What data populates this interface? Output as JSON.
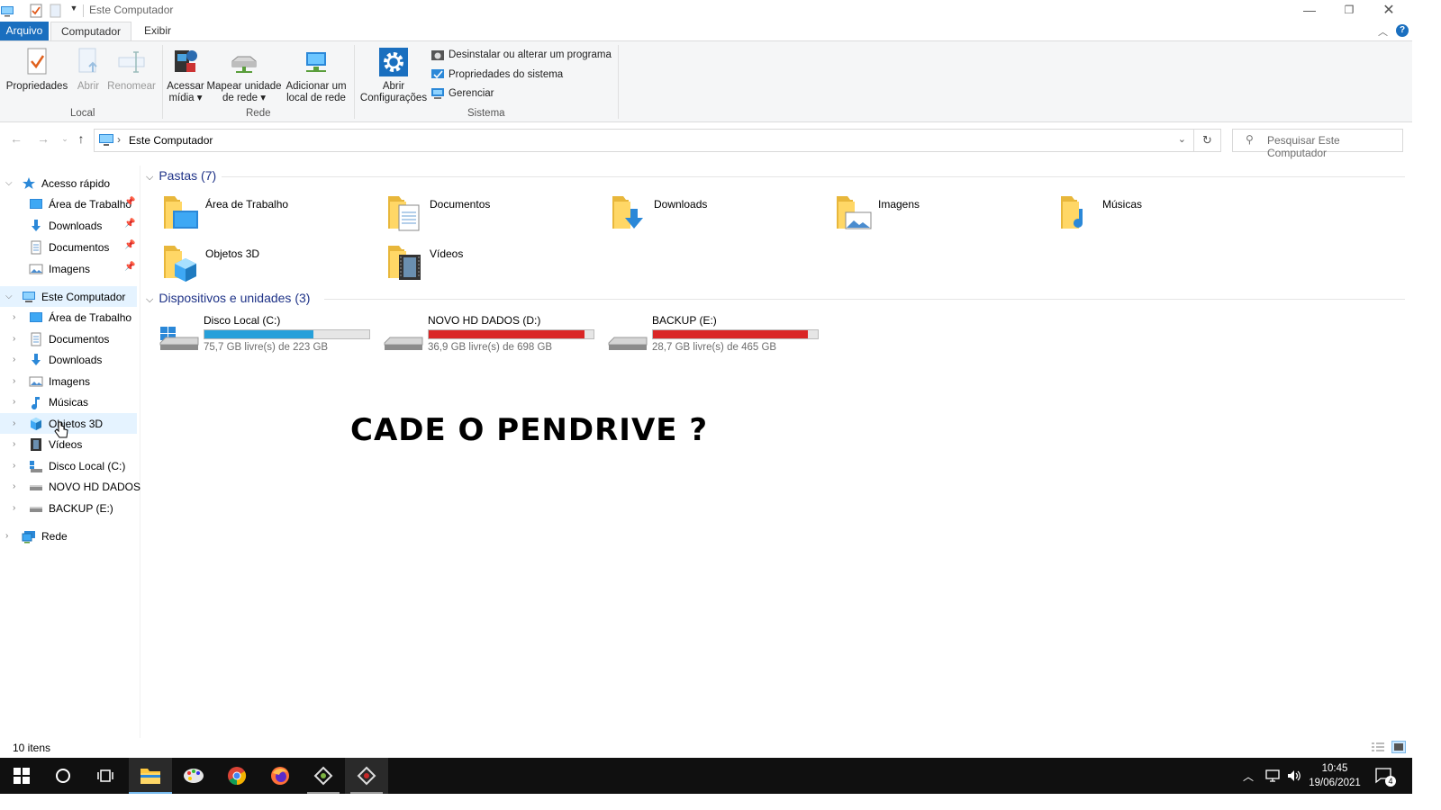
{
  "window": {
    "title": "Este Computador"
  },
  "ribbon": {
    "tabs": {
      "file": "Arquivo",
      "computer": "Computador",
      "view": "Exibir"
    },
    "local": {
      "group_label": "Local",
      "properties": "Propriedades",
      "open": "Abrir",
      "rename": "Renomear"
    },
    "network": {
      "group_label": "Rede",
      "access_media_l1": "Acessar",
      "access_media_l2": "mídia",
      "map_drive_l1": "Mapear unidade",
      "map_drive_l2": "de rede",
      "add_location_l1": "Adicionar um",
      "add_location_l2": "local de rede"
    },
    "system": {
      "group_label": "Sistema",
      "open_settings_l1": "Abrir",
      "open_settings_l2": "Configurações",
      "uninstall": "Desinstalar ou alterar um programa",
      "system_properties": "Propriedades do sistema",
      "manage": "Gerenciar"
    }
  },
  "address": {
    "path": "Este Computador",
    "search_placeholder": "Pesquisar Este Computador"
  },
  "nav": {
    "quick_access": "Acesso rápido",
    "quick_items": [
      "Área de Trabalho",
      "Downloads",
      "Documentos",
      "Imagens"
    ],
    "this_pc": "Este Computador",
    "pc_items": [
      "Área de Trabalho",
      "Documentos",
      "Downloads",
      "Imagens",
      "Músicas",
      "Objetos 3D",
      "Vídeos",
      "Disco Local (C:)",
      "NOVO HD DADOS (",
      "BACKUP (E:)"
    ],
    "network": "Rede"
  },
  "main": {
    "folders_header": "Pastas (7)",
    "folders": [
      "Área de Trabalho",
      "Documentos",
      "Downloads",
      "Imagens",
      "Músicas",
      "Objetos 3D",
      "Vídeos"
    ],
    "devices_header": "Dispositivos e unidades (3)",
    "drives": [
      {
        "name": "Disco Local (C:)",
        "free": "75,7 GB livre(s) de 223 GB",
        "used_fraction": 0.66,
        "color": "#26a0da"
      },
      {
        "name": "NOVO HD DADOS (D:)",
        "free": "36,9 GB livre(s) de 698 GB",
        "used_fraction": 0.947,
        "color": "#da2626"
      },
      {
        "name": "BACKUP (E:)",
        "free": "28,7 GB livre(s) de 465 GB",
        "used_fraction": 0.938,
        "color": "#da2626"
      }
    ],
    "overlay_text": "CADE O PENDRIVE ?"
  },
  "status": {
    "item_count": "10 itens"
  },
  "taskbar": {
    "time": "10:45",
    "date": "19/06/2021",
    "notification_count": "4"
  }
}
